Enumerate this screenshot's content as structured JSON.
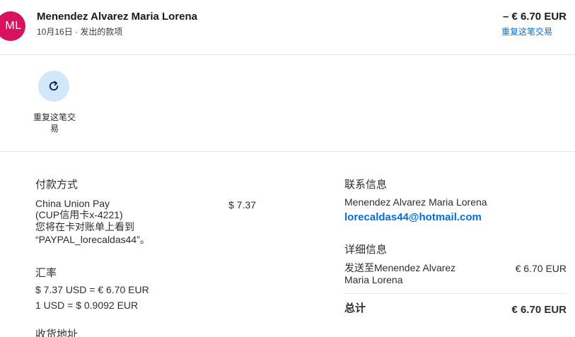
{
  "header": {
    "avatar_initials": "ML",
    "name": "Menendez Alvarez Maria Lorena",
    "subtitle": "10月16日 · 发出的款项",
    "amount": "– € 6.70 EUR",
    "repeat_link": "重复这笔交易"
  },
  "actions": {
    "repeat_label": "重复这笔交易",
    "repeat_icon": "refresh-icon",
    "accent_color": "#0070e0"
  },
  "payment": {
    "title": "付款方式",
    "method_line1": "China Union Pay",
    "method_line2": "(CUP信用卡x-4221)",
    "method_line3": "您将在卡对账单上看到",
    "method_line4": "“PAYPAL_lorecaldas44”。",
    "amount": "$ 7.37"
  },
  "exchange": {
    "title": "汇率",
    "line1": "$ 7.37 USD = € 6.70 EUR",
    "line2": "1 USD = $ 0.9092 EUR"
  },
  "shipping": {
    "title": "收货地址"
  },
  "contact": {
    "title": "联系信息",
    "name": "Menendez Alvarez Maria Lorena",
    "email": "lorecaldas44@hotmail.com"
  },
  "details": {
    "title": "详细信息",
    "sent_to_line1": "发送至Menendez Alvarez",
    "sent_to_line2": "Maria Lorena",
    "sent_amount": "€ 6.70 EUR",
    "total_label": "总计",
    "total_amount": "€ 6.70 EUR"
  }
}
